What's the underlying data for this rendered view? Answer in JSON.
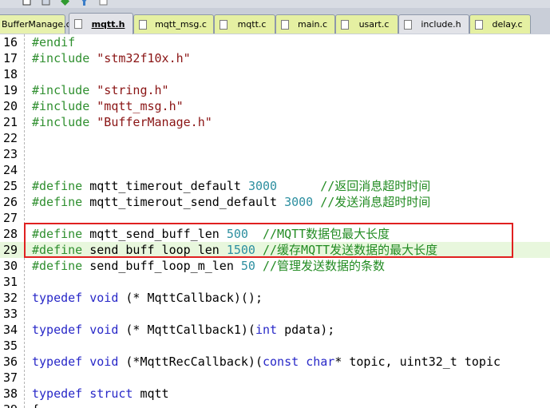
{
  "tabs": [
    {
      "label": "BufferManage.c",
      "kind": "c"
    },
    {
      "label": "mqtt.h",
      "kind": "h",
      "active": true
    },
    {
      "label": "mqtt_msg.c",
      "kind": "c"
    },
    {
      "label": "mqtt.c",
      "kind": "c"
    },
    {
      "label": "main.c",
      "kind": "c"
    },
    {
      "label": "usart.c",
      "kind": "c"
    },
    {
      "label": "include.h",
      "kind": "h"
    },
    {
      "label": "delay.c",
      "kind": "c"
    }
  ],
  "editor": {
    "lines": [
      {
        "n": "16",
        "segs": [
          {
            "t": "#endif",
            "c": "kw-pre"
          }
        ]
      },
      {
        "n": "17",
        "segs": [
          {
            "t": "#include ",
            "c": "kw-pre"
          },
          {
            "t": "\"stm32f10x.h\"",
            "c": "str"
          }
        ]
      },
      {
        "n": "18",
        "segs": []
      },
      {
        "n": "19",
        "segs": [
          {
            "t": "#include ",
            "c": "kw-pre"
          },
          {
            "t": "\"string.h\"",
            "c": "str"
          }
        ]
      },
      {
        "n": "20",
        "segs": [
          {
            "t": "#include ",
            "c": "kw-pre"
          },
          {
            "t": "\"mqtt_msg.h\"",
            "c": "str"
          }
        ]
      },
      {
        "n": "21",
        "segs": [
          {
            "t": "#include ",
            "c": "kw-pre"
          },
          {
            "t": "\"BufferManage.h\"",
            "c": "str"
          }
        ]
      },
      {
        "n": "22",
        "segs": []
      },
      {
        "n": "23",
        "segs": []
      },
      {
        "n": "24",
        "segs": []
      },
      {
        "n": "25",
        "segs": [
          {
            "t": "#define ",
            "c": "kw-pre"
          },
          {
            "t": "mqtt_timerout_default ",
            "c": ""
          },
          {
            "t": "3000",
            "c": "num"
          },
          {
            "t": "      //返回消息超时时间",
            "c": "cmt"
          }
        ]
      },
      {
        "n": "26",
        "segs": [
          {
            "t": "#define ",
            "c": "kw-pre"
          },
          {
            "t": "mqtt_timerout_send_default ",
            "c": ""
          },
          {
            "t": "3000",
            "c": "num"
          },
          {
            "t": " //发送消息超时时间",
            "c": "cmt"
          }
        ]
      },
      {
        "n": "27",
        "segs": []
      },
      {
        "n": "28",
        "segs": [
          {
            "t": "#define ",
            "c": "kw-pre"
          },
          {
            "t": "mqtt_send_buff_len ",
            "c": ""
          },
          {
            "t": "500",
            "c": "num"
          },
          {
            "t": "  //MQTT数据包最大长度",
            "c": "cmt"
          }
        ]
      },
      {
        "n": "29",
        "segs": [
          {
            "t": "#define ",
            "c": "kw-pre"
          },
          {
            "t": "send_buff_loop_len ",
            "c": ""
          },
          {
            "t": "1500",
            "c": "num"
          },
          {
            "t": " //缓存MQTT发送数据的最大长度",
            "c": "cmt"
          }
        ],
        "highlight": true
      },
      {
        "n": "30",
        "segs": [
          {
            "t": "#define ",
            "c": "kw-pre"
          },
          {
            "t": "send_buff_loop_m_len ",
            "c": ""
          },
          {
            "t": "50",
            "c": "num"
          },
          {
            "t": " //管理发送数据的条数",
            "c": "cmt"
          }
        ]
      },
      {
        "n": "31",
        "segs": []
      },
      {
        "n": "32",
        "segs": [
          {
            "t": "typedef ",
            "c": "kw"
          },
          {
            "t": "void",
            "c": "kw"
          },
          {
            "t": " (* MqttCallback)();",
            "c": ""
          }
        ]
      },
      {
        "n": "33",
        "segs": []
      },
      {
        "n": "34",
        "segs": [
          {
            "t": "typedef ",
            "c": "kw"
          },
          {
            "t": "void",
            "c": "kw"
          },
          {
            "t": " (* MqttCallback1)(",
            "c": ""
          },
          {
            "t": "int",
            "c": "kw"
          },
          {
            "t": " pdata);",
            "c": ""
          }
        ]
      },
      {
        "n": "35",
        "segs": []
      },
      {
        "n": "36",
        "segs": [
          {
            "t": "typedef ",
            "c": "kw"
          },
          {
            "t": "void",
            "c": "kw"
          },
          {
            "t": " (*MqttRecCallback)(",
            "c": ""
          },
          {
            "t": "const",
            "c": "kw"
          },
          {
            "t": " ",
            "c": ""
          },
          {
            "t": "char",
            "c": "kw"
          },
          {
            "t": "* topic, uint32_t topic",
            "c": ""
          }
        ]
      },
      {
        "n": "37",
        "segs": []
      },
      {
        "n": "38",
        "segs": [
          {
            "t": "typedef ",
            "c": "kw"
          },
          {
            "t": "struct",
            "c": "kw"
          },
          {
            "t": " mqtt",
            "c": ""
          }
        ]
      },
      {
        "n": "39",
        "segs": [
          {
            "t": "{",
            "c": ""
          }
        ]
      }
    ]
  },
  "colors": {
    "annotation_box": "#e02020",
    "active_tab": "#ffc1cc",
    "c_tab": "#e5f0a2",
    "h_tab": "#e2e3e8"
  }
}
